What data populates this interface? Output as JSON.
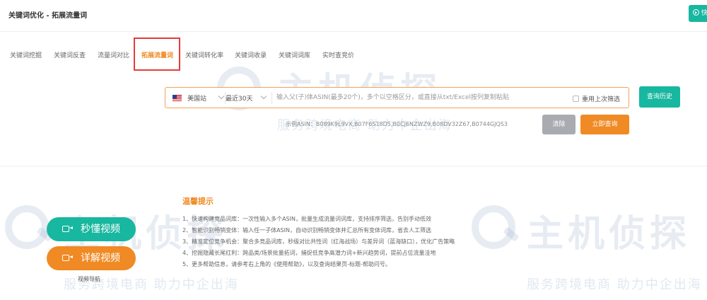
{
  "header": {
    "title": "关键词优化 - 拓展流量词",
    "right_button_label": "快"
  },
  "tabs": [
    {
      "label": "关键词挖掘",
      "active": false
    },
    {
      "label": "关键词反查",
      "active": false
    },
    {
      "label": "流量词对比",
      "active": false
    },
    {
      "label": "拓展流量词",
      "active": true
    },
    {
      "label": "关键词转化率",
      "active": false
    },
    {
      "label": "关键词收录",
      "active": false
    },
    {
      "label": "关键词词库",
      "active": false
    },
    {
      "label": "实时查竞价",
      "active": false
    }
  ],
  "query": {
    "marketplace": "美国站",
    "marketplace_flag_icon": "us-flag-icon",
    "period": "最近30天",
    "asin_placeholder": "输入父(子)体ASIN(最多20个)，多个以空格区分，或直接从txt/Excel按列复制粘贴",
    "reuse_filter_label": "重用上次筛选",
    "reuse_filter_checked": false,
    "history_button": "查询历史",
    "example": "示例ASIN：B089K9L9VX,B07F6S18D5,B0CJ6NZWZ9,B08DV32Z67,B0744GJQS3",
    "clear_button": "清除",
    "submit_button": "立即查询"
  },
  "tips": {
    "title": "温馨提示",
    "items": [
      "1、快速构建竞品词库：一次性输入多个ASIN，批量生成流量词词库，支持排序筛选，告别手动低效",
      "2、智能识别畅销变体：输入任一子体ASIN，自动识别畅销变体并汇总所有变体词库，省去人工筛选",
      "3、精准定位竞争机会：聚合多竞品词库，秒级对比共性词（红海战场）与差异词（蓝海缺口），优化广告策略",
      "4、挖掘隐藏长尾红利：跨品类/场景批量拓词，捕捉低竞争高潜力词+新兴趋势词，提前占位流量洼地",
      "5、更多帮助信息，请参考右上角的《使用帮助》，以及查询结果页-标题-帮助问号。"
    ]
  },
  "videos": {
    "quick_label": "秒懂视频",
    "detail_label": "详解视频",
    "nav_label": "视频导航"
  },
  "watermark": {
    "main": "主机侦探",
    "sub": "服务跨境电商 助力中企出海"
  },
  "colors": {
    "accent_green": "#18b79f",
    "accent_orange": "#f08a24",
    "highlight_red": "#e53b3b"
  }
}
